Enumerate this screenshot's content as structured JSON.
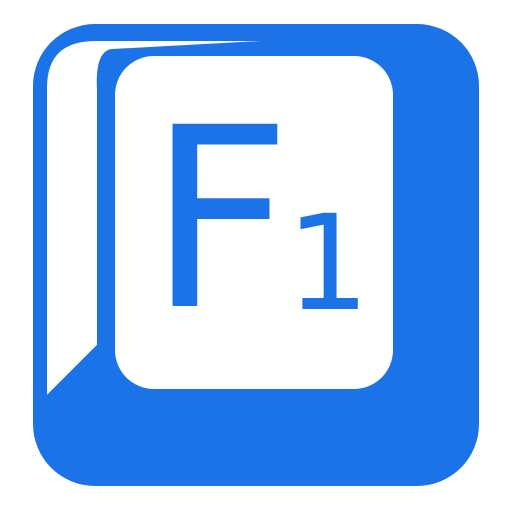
{
  "icon": {
    "name": "f1-key-icon",
    "letter": "F",
    "number": "1",
    "colors": {
      "key": "#1c73e8",
      "face": "#ffffff",
      "background": "#ffffff"
    }
  }
}
